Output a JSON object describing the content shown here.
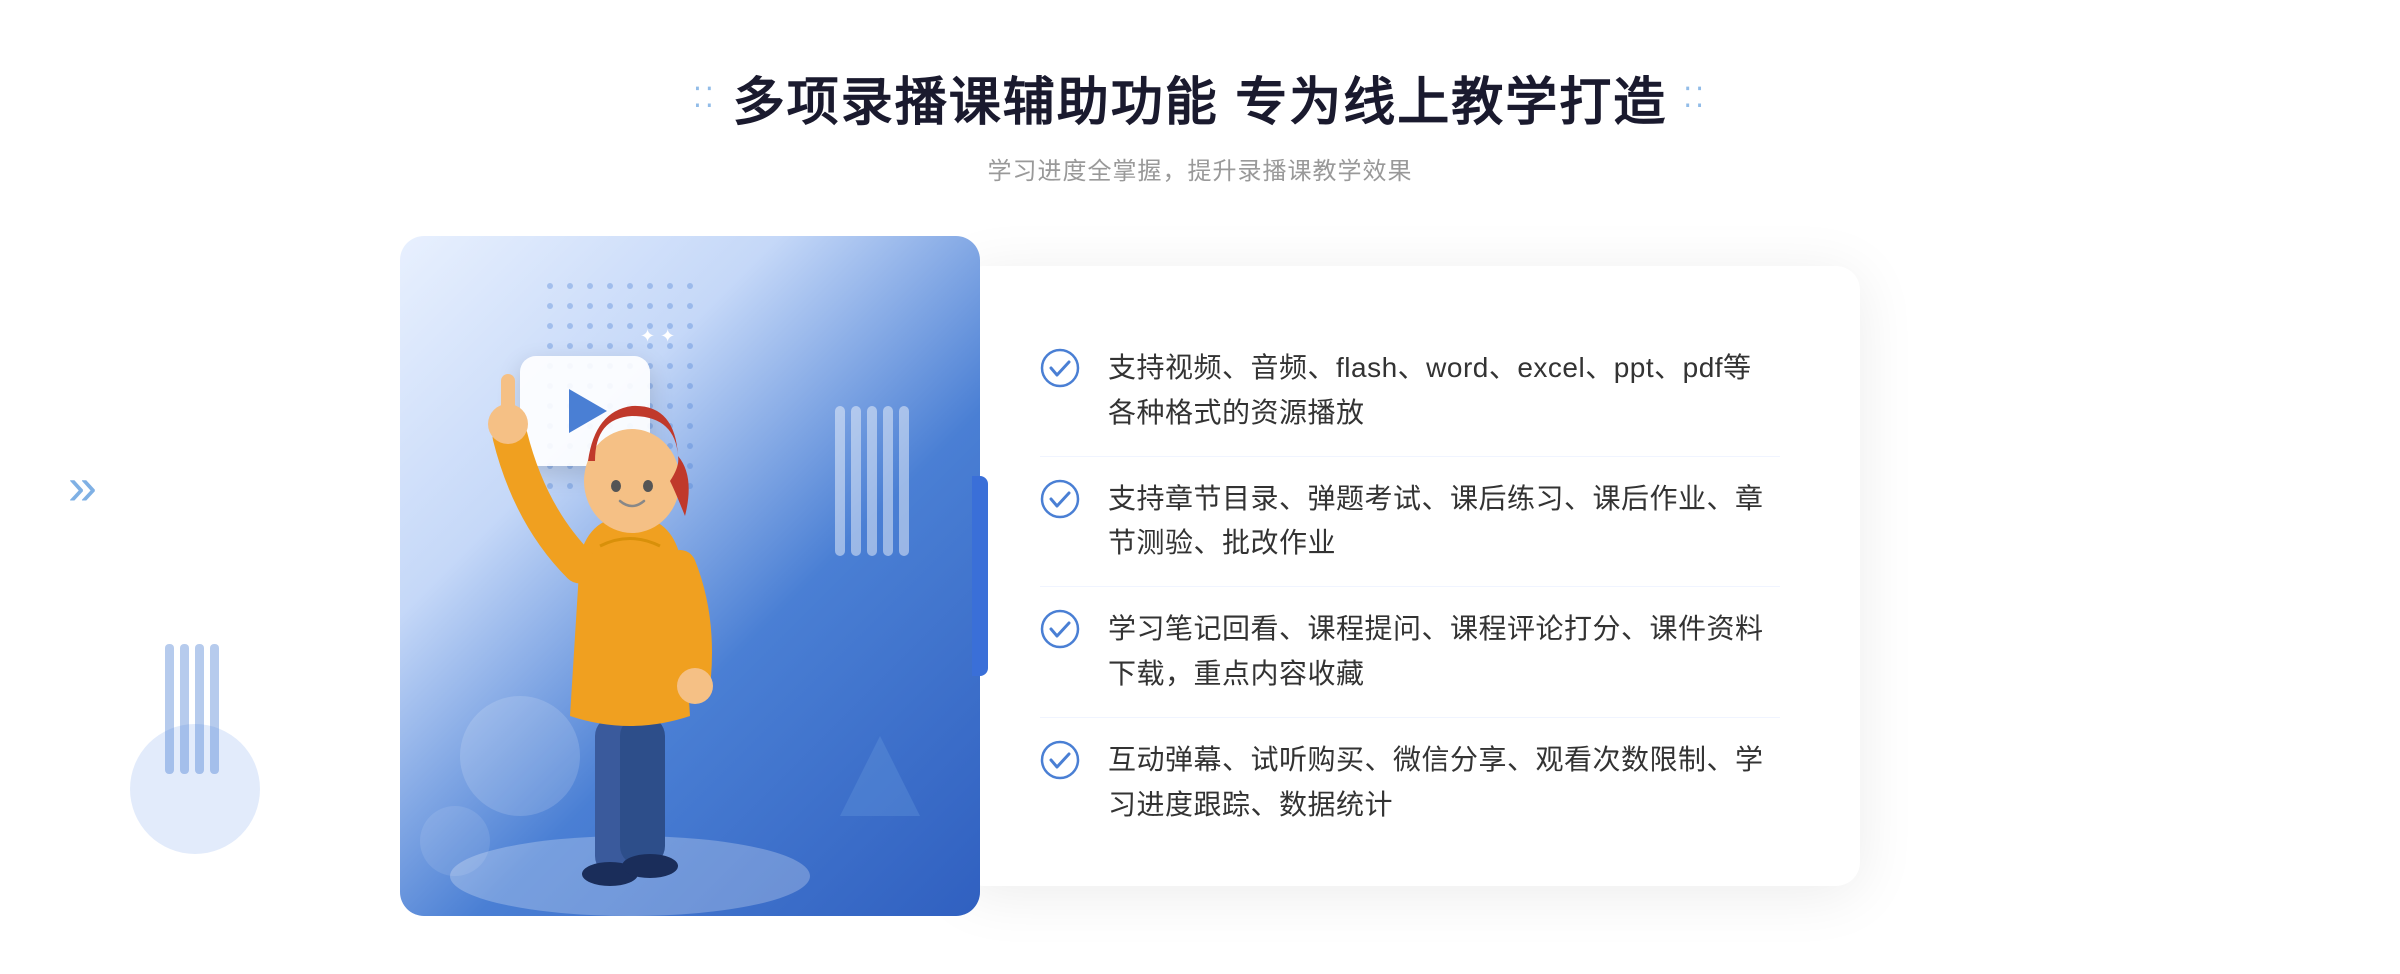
{
  "header": {
    "title": "多项录播课辅助功能 专为线上教学打造",
    "subtitle": "学习进度全掌握，提升录播课教学效果",
    "title_dots_left": "⁞⁞",
    "title_dots_right": "⁞⁞"
  },
  "features": [
    {
      "id": 1,
      "text": "支持视频、音频、flash、word、excel、ppt、pdf等各种格式的资源播放"
    },
    {
      "id": 2,
      "text": "支持章节目录、弹题考试、课后练习、课后作业、章节测验、批改作业"
    },
    {
      "id": 3,
      "text": "学习笔记回看、课程提问、课程评论打分、课件资料下载，重点内容收藏"
    },
    {
      "id": 4,
      "text": "互动弹幕、试听购买、微信分享、观看次数限制、学习进度跟踪、数据统计"
    }
  ],
  "colors": {
    "primary": "#4a7fd4",
    "light_blue": "#e8f2ff",
    "text_dark": "#1a1a2e",
    "text_gray": "#999999",
    "text_body": "#333333",
    "check_color": "#4a7fd4"
  }
}
